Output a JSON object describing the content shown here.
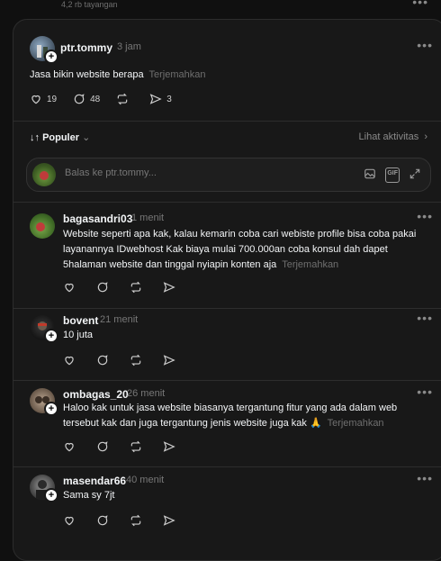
{
  "top": {
    "views": "4,2 rb tayangan"
  },
  "post": {
    "username": "ptr.tommy",
    "time": "3 jam",
    "text": "Jasa bikin website berapa",
    "translate": "Terjemahkan",
    "likes": "19",
    "comments": "48",
    "shares": "3"
  },
  "sort": {
    "label": "Populer",
    "activity": "Lihat aktivitas"
  },
  "reply_box": {
    "placeholder": "Balas ke ptr.tommy..."
  },
  "comments": [
    {
      "username": "bagasandri03",
      "time": "1 menit",
      "text": "Website seperti apa kak, kalau kemarin coba cari webiste profile bisa coba pakai layanannya IDwebhost Kak biaya mulai 700.000an coba konsul dah dapet 5halaman website dan tinggal nyiapin konten aja",
      "translate": "Terjemahkan"
    },
    {
      "username": "bovent",
      "time": "21 menit",
      "text": "10 juta"
    },
    {
      "username": "ombagas_20",
      "time": "26 menit",
      "text": "Haloo kak untuk jasa website biasanya tergantung fitur yang ada dalam web tersebut kak dan juga tergantung jenis website juga kak 🙏",
      "translate": "Terjemahkan"
    },
    {
      "username": "masendar66",
      "time": "40 menit",
      "text": "Sama sy 7jt"
    }
  ],
  "colors": {
    "bg": "#101010",
    "card": "#181818",
    "muted": "#777777",
    "text": "#f3f5f7"
  }
}
